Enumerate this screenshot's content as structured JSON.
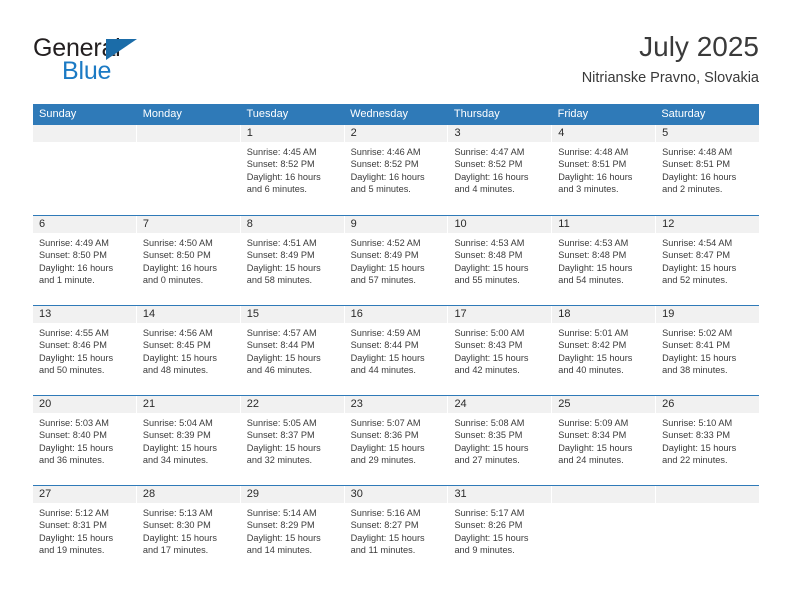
{
  "brand": {
    "name_part1": "General",
    "name_part2": "Blue",
    "triangle_icon": "triangle-icon",
    "color_dark": "#231f20",
    "color_blue": "#1b7ac4"
  },
  "header": {
    "title": "July 2025",
    "subtitle": "Nitrianske Pravno, Slovakia"
  },
  "theme": {
    "header_blue": "#2f7ab8",
    "daynum_gray": "#f1f1f1",
    "text": "#3b3b3b"
  },
  "weekdays": [
    "Sunday",
    "Monday",
    "Tuesday",
    "Wednesday",
    "Thursday",
    "Friday",
    "Saturday"
  ],
  "weeks": [
    [
      {
        "day": "",
        "sunrise": "",
        "sunset": "",
        "daylight1": "",
        "daylight2": ""
      },
      {
        "day": "",
        "sunrise": "",
        "sunset": "",
        "daylight1": "",
        "daylight2": ""
      },
      {
        "day": "1",
        "sunrise": "Sunrise: 4:45 AM",
        "sunset": "Sunset: 8:52 PM",
        "daylight1": "Daylight: 16 hours",
        "daylight2": "and 6 minutes."
      },
      {
        "day": "2",
        "sunrise": "Sunrise: 4:46 AM",
        "sunset": "Sunset: 8:52 PM",
        "daylight1": "Daylight: 16 hours",
        "daylight2": "and 5 minutes."
      },
      {
        "day": "3",
        "sunrise": "Sunrise: 4:47 AM",
        "sunset": "Sunset: 8:52 PM",
        "daylight1": "Daylight: 16 hours",
        "daylight2": "and 4 minutes."
      },
      {
        "day": "4",
        "sunrise": "Sunrise: 4:48 AM",
        "sunset": "Sunset: 8:51 PM",
        "daylight1": "Daylight: 16 hours",
        "daylight2": "and 3 minutes."
      },
      {
        "day": "5",
        "sunrise": "Sunrise: 4:48 AM",
        "sunset": "Sunset: 8:51 PM",
        "daylight1": "Daylight: 16 hours",
        "daylight2": "and 2 minutes."
      }
    ],
    [
      {
        "day": "6",
        "sunrise": "Sunrise: 4:49 AM",
        "sunset": "Sunset: 8:50 PM",
        "daylight1": "Daylight: 16 hours",
        "daylight2": "and 1 minute."
      },
      {
        "day": "7",
        "sunrise": "Sunrise: 4:50 AM",
        "sunset": "Sunset: 8:50 PM",
        "daylight1": "Daylight: 16 hours",
        "daylight2": "and 0 minutes."
      },
      {
        "day": "8",
        "sunrise": "Sunrise: 4:51 AM",
        "sunset": "Sunset: 8:49 PM",
        "daylight1": "Daylight: 15 hours",
        "daylight2": "and 58 minutes."
      },
      {
        "day": "9",
        "sunrise": "Sunrise: 4:52 AM",
        "sunset": "Sunset: 8:49 PM",
        "daylight1": "Daylight: 15 hours",
        "daylight2": "and 57 minutes."
      },
      {
        "day": "10",
        "sunrise": "Sunrise: 4:53 AM",
        "sunset": "Sunset: 8:48 PM",
        "daylight1": "Daylight: 15 hours",
        "daylight2": "and 55 minutes."
      },
      {
        "day": "11",
        "sunrise": "Sunrise: 4:53 AM",
        "sunset": "Sunset: 8:48 PM",
        "daylight1": "Daylight: 15 hours",
        "daylight2": "and 54 minutes."
      },
      {
        "day": "12",
        "sunrise": "Sunrise: 4:54 AM",
        "sunset": "Sunset: 8:47 PM",
        "daylight1": "Daylight: 15 hours",
        "daylight2": "and 52 minutes."
      }
    ],
    [
      {
        "day": "13",
        "sunrise": "Sunrise: 4:55 AM",
        "sunset": "Sunset: 8:46 PM",
        "daylight1": "Daylight: 15 hours",
        "daylight2": "and 50 minutes."
      },
      {
        "day": "14",
        "sunrise": "Sunrise: 4:56 AM",
        "sunset": "Sunset: 8:45 PM",
        "daylight1": "Daylight: 15 hours",
        "daylight2": "and 48 minutes."
      },
      {
        "day": "15",
        "sunrise": "Sunrise: 4:57 AM",
        "sunset": "Sunset: 8:44 PM",
        "daylight1": "Daylight: 15 hours",
        "daylight2": "and 46 minutes."
      },
      {
        "day": "16",
        "sunrise": "Sunrise: 4:59 AM",
        "sunset": "Sunset: 8:44 PM",
        "daylight1": "Daylight: 15 hours",
        "daylight2": "and 44 minutes."
      },
      {
        "day": "17",
        "sunrise": "Sunrise: 5:00 AM",
        "sunset": "Sunset: 8:43 PM",
        "daylight1": "Daylight: 15 hours",
        "daylight2": "and 42 minutes."
      },
      {
        "day": "18",
        "sunrise": "Sunrise: 5:01 AM",
        "sunset": "Sunset: 8:42 PM",
        "daylight1": "Daylight: 15 hours",
        "daylight2": "and 40 minutes."
      },
      {
        "day": "19",
        "sunrise": "Sunrise: 5:02 AM",
        "sunset": "Sunset: 8:41 PM",
        "daylight1": "Daylight: 15 hours",
        "daylight2": "and 38 minutes."
      }
    ],
    [
      {
        "day": "20",
        "sunrise": "Sunrise: 5:03 AM",
        "sunset": "Sunset: 8:40 PM",
        "daylight1": "Daylight: 15 hours",
        "daylight2": "and 36 minutes."
      },
      {
        "day": "21",
        "sunrise": "Sunrise: 5:04 AM",
        "sunset": "Sunset: 8:39 PM",
        "daylight1": "Daylight: 15 hours",
        "daylight2": "and 34 minutes."
      },
      {
        "day": "22",
        "sunrise": "Sunrise: 5:05 AM",
        "sunset": "Sunset: 8:37 PM",
        "daylight1": "Daylight: 15 hours",
        "daylight2": "and 32 minutes."
      },
      {
        "day": "23",
        "sunrise": "Sunrise: 5:07 AM",
        "sunset": "Sunset: 8:36 PM",
        "daylight1": "Daylight: 15 hours",
        "daylight2": "and 29 minutes."
      },
      {
        "day": "24",
        "sunrise": "Sunrise: 5:08 AM",
        "sunset": "Sunset: 8:35 PM",
        "daylight1": "Daylight: 15 hours",
        "daylight2": "and 27 minutes."
      },
      {
        "day": "25",
        "sunrise": "Sunrise: 5:09 AM",
        "sunset": "Sunset: 8:34 PM",
        "daylight1": "Daylight: 15 hours",
        "daylight2": "and 24 minutes."
      },
      {
        "day": "26",
        "sunrise": "Sunrise: 5:10 AM",
        "sunset": "Sunset: 8:33 PM",
        "daylight1": "Daylight: 15 hours",
        "daylight2": "and 22 minutes."
      }
    ],
    [
      {
        "day": "27",
        "sunrise": "Sunrise: 5:12 AM",
        "sunset": "Sunset: 8:31 PM",
        "daylight1": "Daylight: 15 hours",
        "daylight2": "and 19 minutes."
      },
      {
        "day": "28",
        "sunrise": "Sunrise: 5:13 AM",
        "sunset": "Sunset: 8:30 PM",
        "daylight1": "Daylight: 15 hours",
        "daylight2": "and 17 minutes."
      },
      {
        "day": "29",
        "sunrise": "Sunrise: 5:14 AM",
        "sunset": "Sunset: 8:29 PM",
        "daylight1": "Daylight: 15 hours",
        "daylight2": "and 14 minutes."
      },
      {
        "day": "30",
        "sunrise": "Sunrise: 5:16 AM",
        "sunset": "Sunset: 8:27 PM",
        "daylight1": "Daylight: 15 hours",
        "daylight2": "and 11 minutes."
      },
      {
        "day": "31",
        "sunrise": "Sunrise: 5:17 AM",
        "sunset": "Sunset: 8:26 PM",
        "daylight1": "Daylight: 15 hours",
        "daylight2": "and 9 minutes."
      },
      {
        "day": "",
        "sunrise": "",
        "sunset": "",
        "daylight1": "",
        "daylight2": ""
      },
      {
        "day": "",
        "sunrise": "",
        "sunset": "",
        "daylight1": "",
        "daylight2": ""
      }
    ]
  ]
}
